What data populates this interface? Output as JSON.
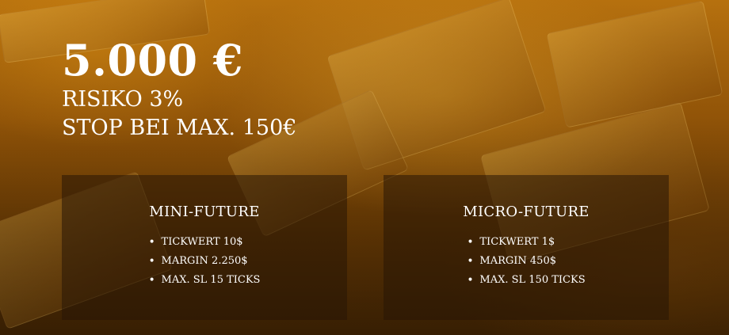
{
  "headline": {
    "price": "5.000 €",
    "risk": "RISIKO 3%",
    "stop": "STOP BEI MAX. 150€"
  },
  "cards": [
    {
      "title": "MINI-FUTURE",
      "items": [
        "TICKWERT 10$",
        "MARGIN 2.250$",
        "MAX. SL 15 TICKS"
      ]
    },
    {
      "title": "MICRO-FUTURE",
      "items": [
        "TICKWERT 1$",
        "MARGIN 450$",
        "MAX. SL 150 TICKS"
      ]
    }
  ],
  "colors": {
    "text": "#ffffff",
    "background": "#a8620a",
    "card": "#28160580"
  }
}
